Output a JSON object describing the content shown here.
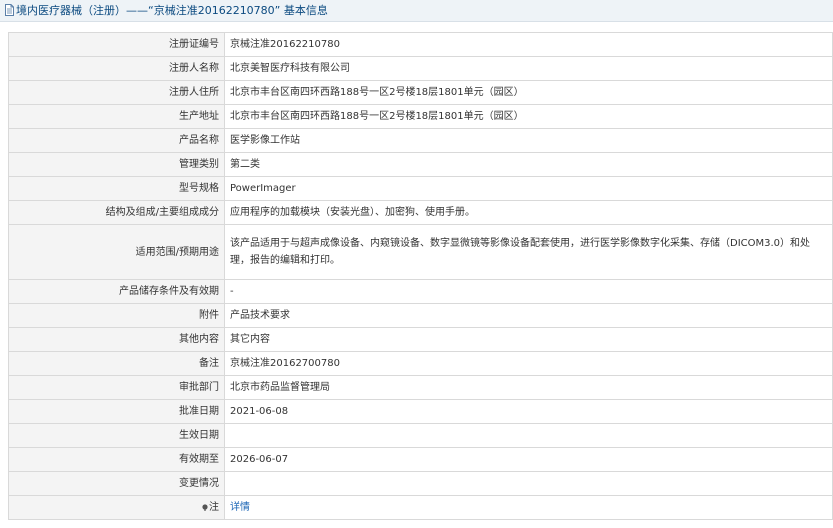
{
  "header": {
    "title": "境内医疗器械（注册）——“京械注准20162210780” 基本信息",
    "icon": "document-icon"
  },
  "rows": [
    {
      "label": "注册证编号",
      "value": "京械注准20162210780"
    },
    {
      "label": "注册人名称",
      "value": "北京美智医疗科技有限公司"
    },
    {
      "label": "注册人住所",
      "value": "北京市丰台区南四环西路188号一区2号楼18层1801单元（园区）"
    },
    {
      "label": "生产地址",
      "value": "北京市丰台区南四环西路188号一区2号楼18层1801单元（园区）"
    },
    {
      "label": "产品名称",
      "value": "医学影像工作站"
    },
    {
      "label": "管理类别",
      "value": "第二类"
    },
    {
      "label": "型号规格",
      "value": "PowerImager"
    },
    {
      "label": "结构及组成/主要组成成分",
      "value": "应用程序的加载模块（安装光盘）、加密狗、使用手册。"
    },
    {
      "label": "适用范围/预期用途",
      "value": "该产品适用于与超声成像设备、内窥镜设备、数字显微镜等影像设备配套使用，进行医学影像数字化采集、存储（DICOM3.0）和处理，报告的编辑和打印。"
    },
    {
      "label": "产品储存条件及有效期",
      "value": "-"
    },
    {
      "label": "附件",
      "value": "产品技术要求"
    },
    {
      "label": "其他内容",
      "value": "其它内容"
    },
    {
      "label": "备注",
      "value": "京械注准20162700780"
    },
    {
      "label": "审批部门",
      "value": "北京市药品监督管理局"
    },
    {
      "label": "批准日期",
      "value": "2021-06-08"
    },
    {
      "label": "生效日期",
      "value": ""
    },
    {
      "label": "有效期至",
      "value": "2026-06-07"
    },
    {
      "label": "变更情况",
      "value": ""
    }
  ],
  "note_row": {
    "label": "注",
    "link_text": "详情",
    "icon": "note-icon"
  },
  "colors": {
    "header_bg": "#eef3f7",
    "title": "#0b4a80",
    "label_bg": "#f4f4f4",
    "border": "#d9d9d9",
    "link": "#1a64b4"
  }
}
